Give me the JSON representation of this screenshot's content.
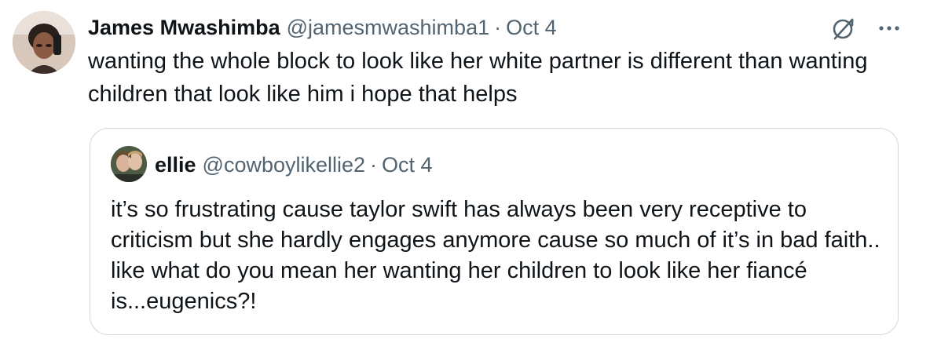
{
  "tweet": {
    "display_name": "James Mwashimba",
    "handle": "@jamesmwashimba1",
    "separator": "·",
    "date": "Oct 4",
    "text": "wanting the whole block to look like her white partner is different than wanting children that look like him i hope that helps",
    "icons": {
      "grok": "grok-icon",
      "more": "more-icon"
    }
  },
  "quote": {
    "display_name": "ellie",
    "handle": "@cowboylikellie2",
    "separator": "·",
    "date": "Oct 4",
    "text": "it’s so frustrating cause taylor swift has always been very receptive to criticism but she hardly engages anymore cause so much of it’s in bad faith.. like what do you mean her wanting her children to look like her fiancé is...eugenics?!"
  },
  "colors": {
    "text_primary": "#0f1419",
    "text_secondary": "#536471",
    "border": "#cfd9de"
  }
}
